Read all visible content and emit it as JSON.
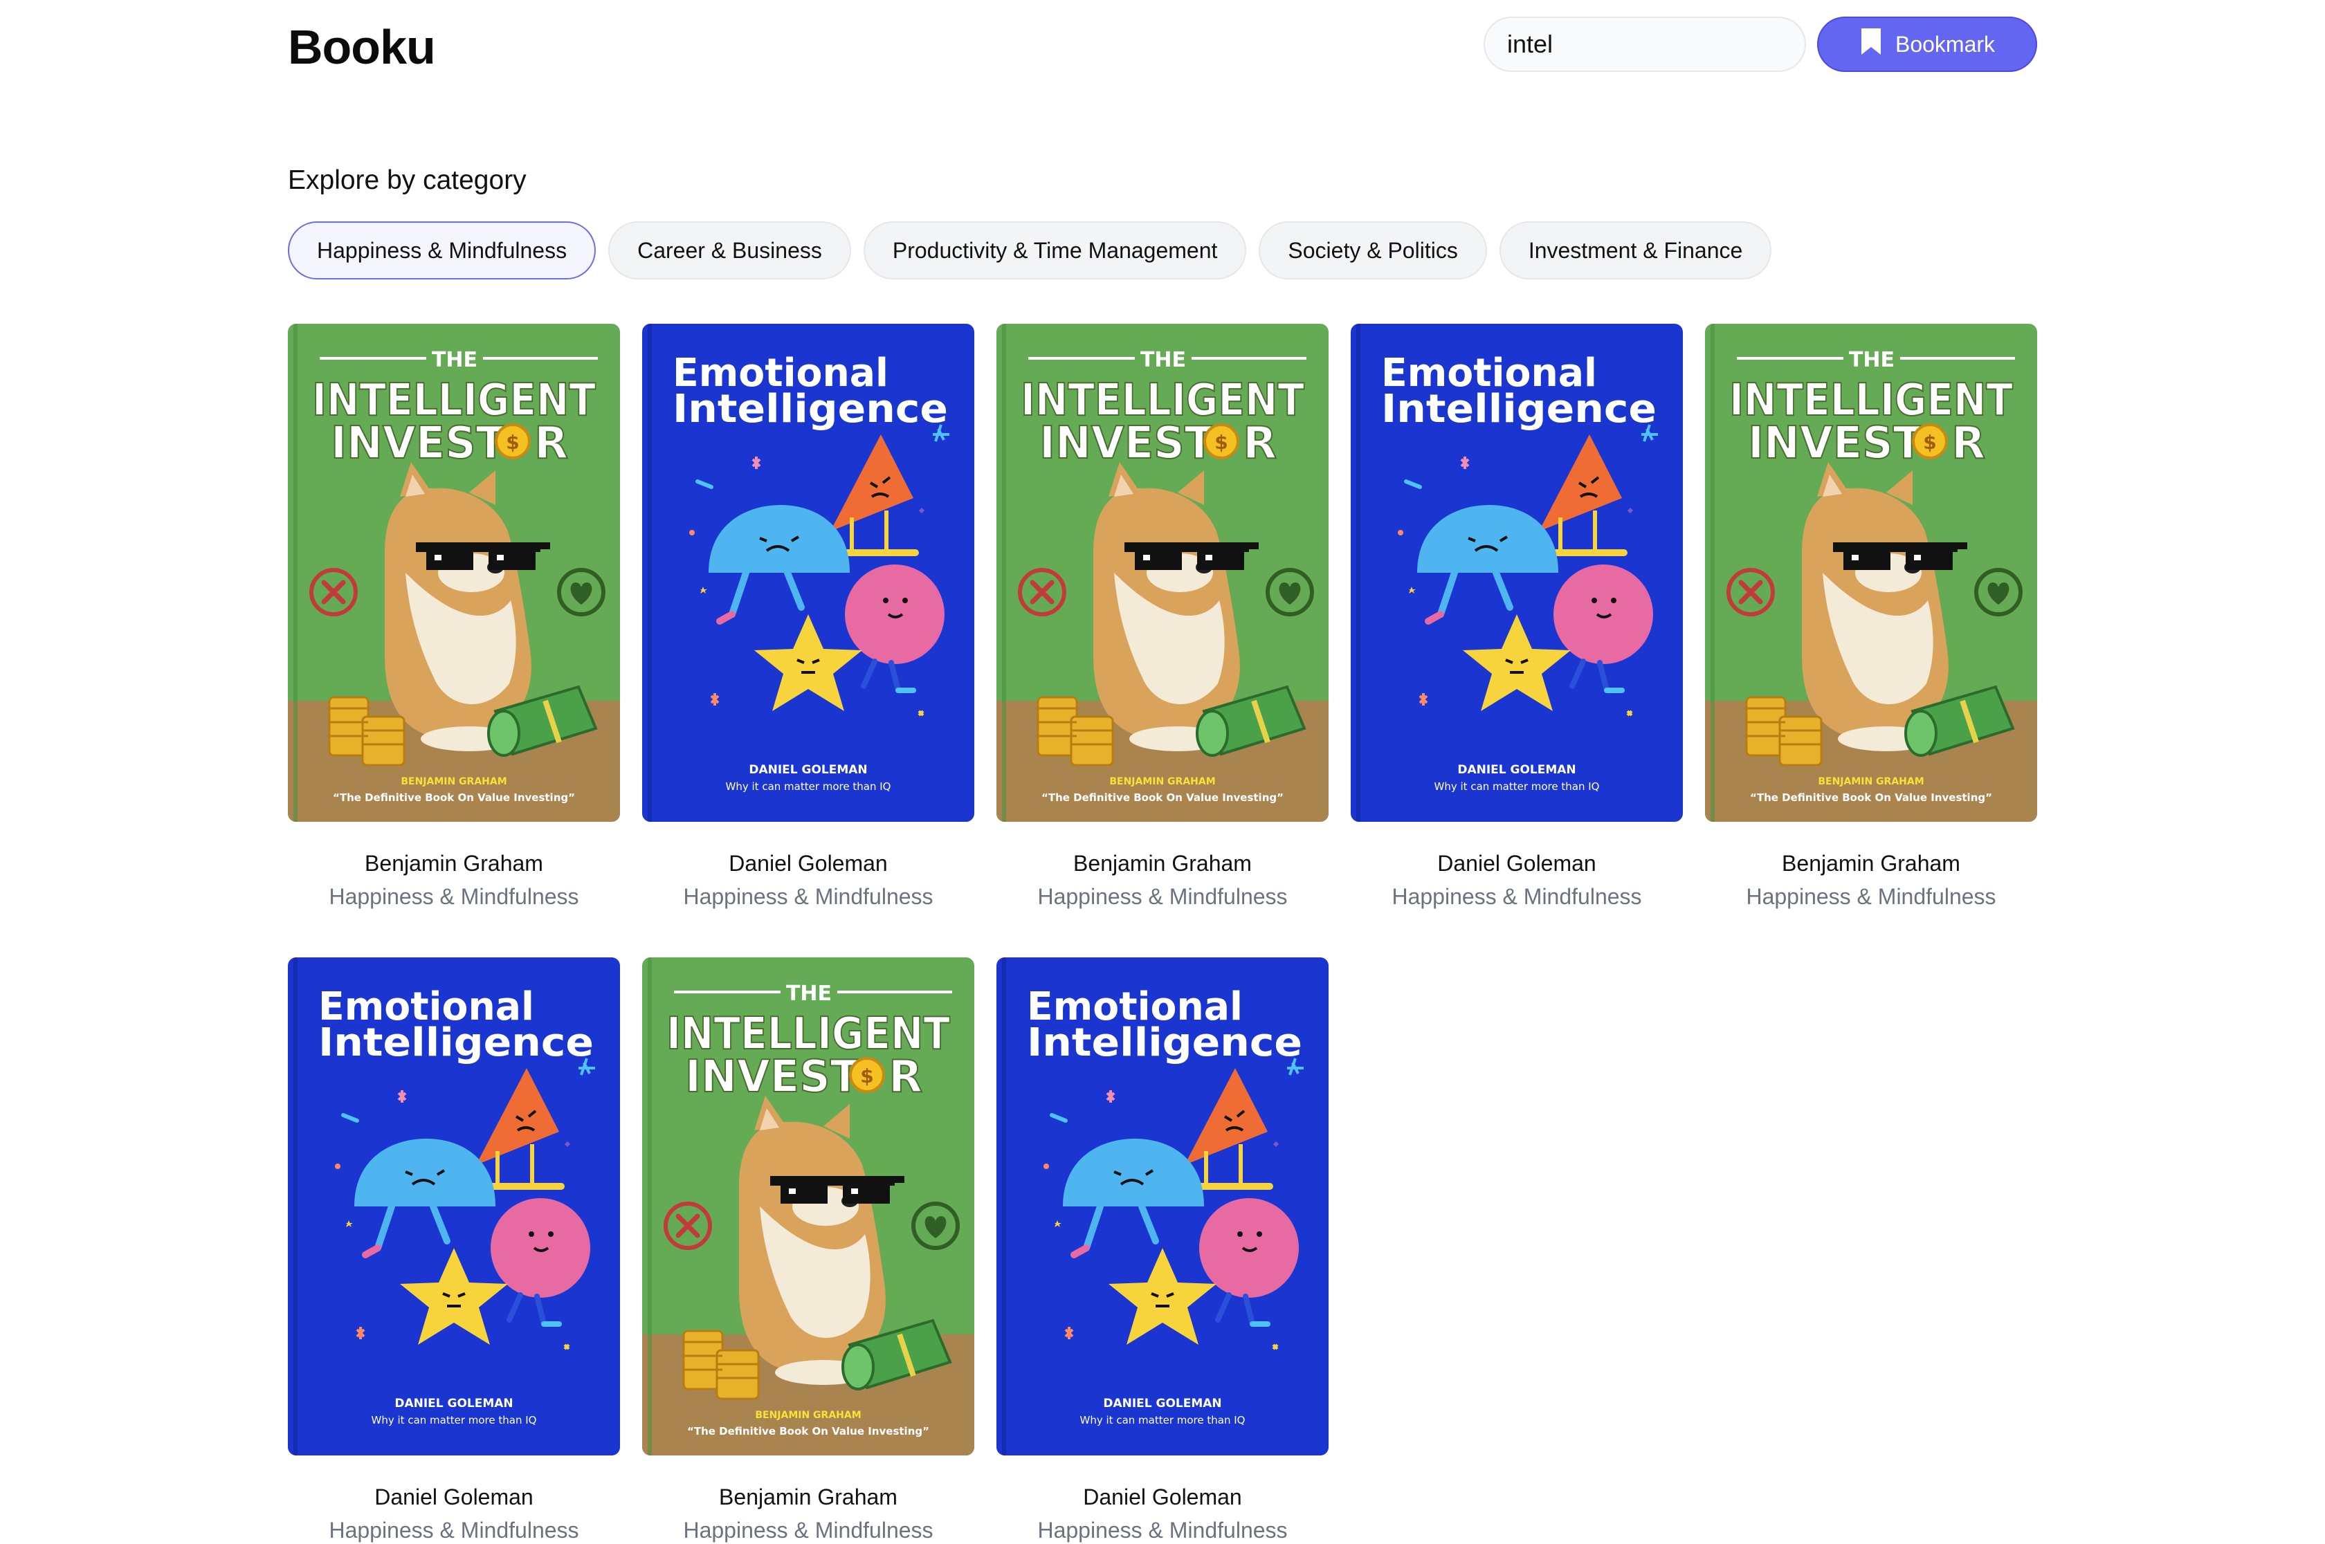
{
  "app": {
    "title": "Booku"
  },
  "search": {
    "value": "intel"
  },
  "bookmark_button": {
    "label": "Bookmark"
  },
  "categories": {
    "title": "Explore by category",
    "items": [
      {
        "label": "Happiness & Mindfulness",
        "active": true
      },
      {
        "label": "Career & Business",
        "active": false
      },
      {
        "label": "Productivity & Time Management",
        "active": false
      },
      {
        "label": "Society & Politics",
        "active": false
      },
      {
        "label": "Investment & Finance",
        "active": false
      }
    ]
  },
  "cover_text": {
    "investor": {
      "the": "THE",
      "line1": "INTELLIGENT",
      "line2a": "INVEST",
      "line2b": "R",
      "coin": "$",
      "author": "BENJAMIN GRAHAM",
      "tagline": "“The Definitive Book On Value Investing”"
    },
    "emotional": {
      "line1": "Emotional",
      "line2": "Intelligence",
      "author": "DANIEL GOLEMAN",
      "tagline": "Why it can matter more than IQ"
    }
  },
  "books": [
    {
      "cover": "investor",
      "author": "Benjamin Graham",
      "category": "Happiness & Mindfulness"
    },
    {
      "cover": "emotional",
      "author": "Daniel Goleman",
      "category": "Happiness & Mindfulness"
    },
    {
      "cover": "investor",
      "author": "Benjamin Graham",
      "category": "Happiness & Mindfulness"
    },
    {
      "cover": "emotional",
      "author": "Daniel Goleman",
      "category": "Happiness & Mindfulness"
    },
    {
      "cover": "investor",
      "author": "Benjamin Graham",
      "category": "Happiness & Mindfulness"
    },
    {
      "cover": "emotional",
      "author": "Daniel Goleman",
      "category": "Happiness & Mindfulness"
    },
    {
      "cover": "investor",
      "author": "Benjamin Graham",
      "category": "Happiness & Mindfulness"
    },
    {
      "cover": "emotional",
      "author": "Daniel Goleman",
      "category": "Happiness & Mindfulness"
    }
  ],
  "colors": {
    "accent": "#6366f1",
    "investor_green": "#65ab55",
    "investor_ground": "#a9844f",
    "emotional_blue": "#1a35d0"
  }
}
